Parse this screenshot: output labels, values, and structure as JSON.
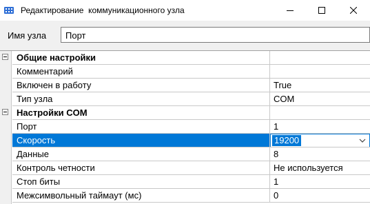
{
  "window": {
    "title": "Редактирование  коммуникационного узла",
    "icon": "network-node-icon",
    "controls": [
      "minimize-icon",
      "maximize-icon",
      "close-icon"
    ]
  },
  "node": {
    "label": "Имя узла",
    "value": "Порт"
  },
  "grid": {
    "general": {
      "title": "Общие настройки",
      "rows": [
        {
          "name": "Комментарий",
          "value": ""
        },
        {
          "name": "Включен в работу",
          "value": "True"
        },
        {
          "name": "Тип узла",
          "value": "COM"
        }
      ]
    },
    "com": {
      "title": "Настройки COM",
      "rows": [
        {
          "name": "Порт",
          "value": "1"
        },
        {
          "name": "Скорость",
          "value": "19200"
        },
        {
          "name": "Данные",
          "value": "8"
        },
        {
          "name": "Контроль четности",
          "value": "Не используется"
        },
        {
          "name": "Стоп биты",
          "value": "1"
        },
        {
          "name": "Межсимвольный таймаут (мс)",
          "value": "0"
        }
      ]
    },
    "selected_row": "Скорость"
  },
  "colors": {
    "selection": "#0078d7",
    "dialog_bg": "#f0f0f0",
    "grid_line": "#c8c8c8"
  }
}
